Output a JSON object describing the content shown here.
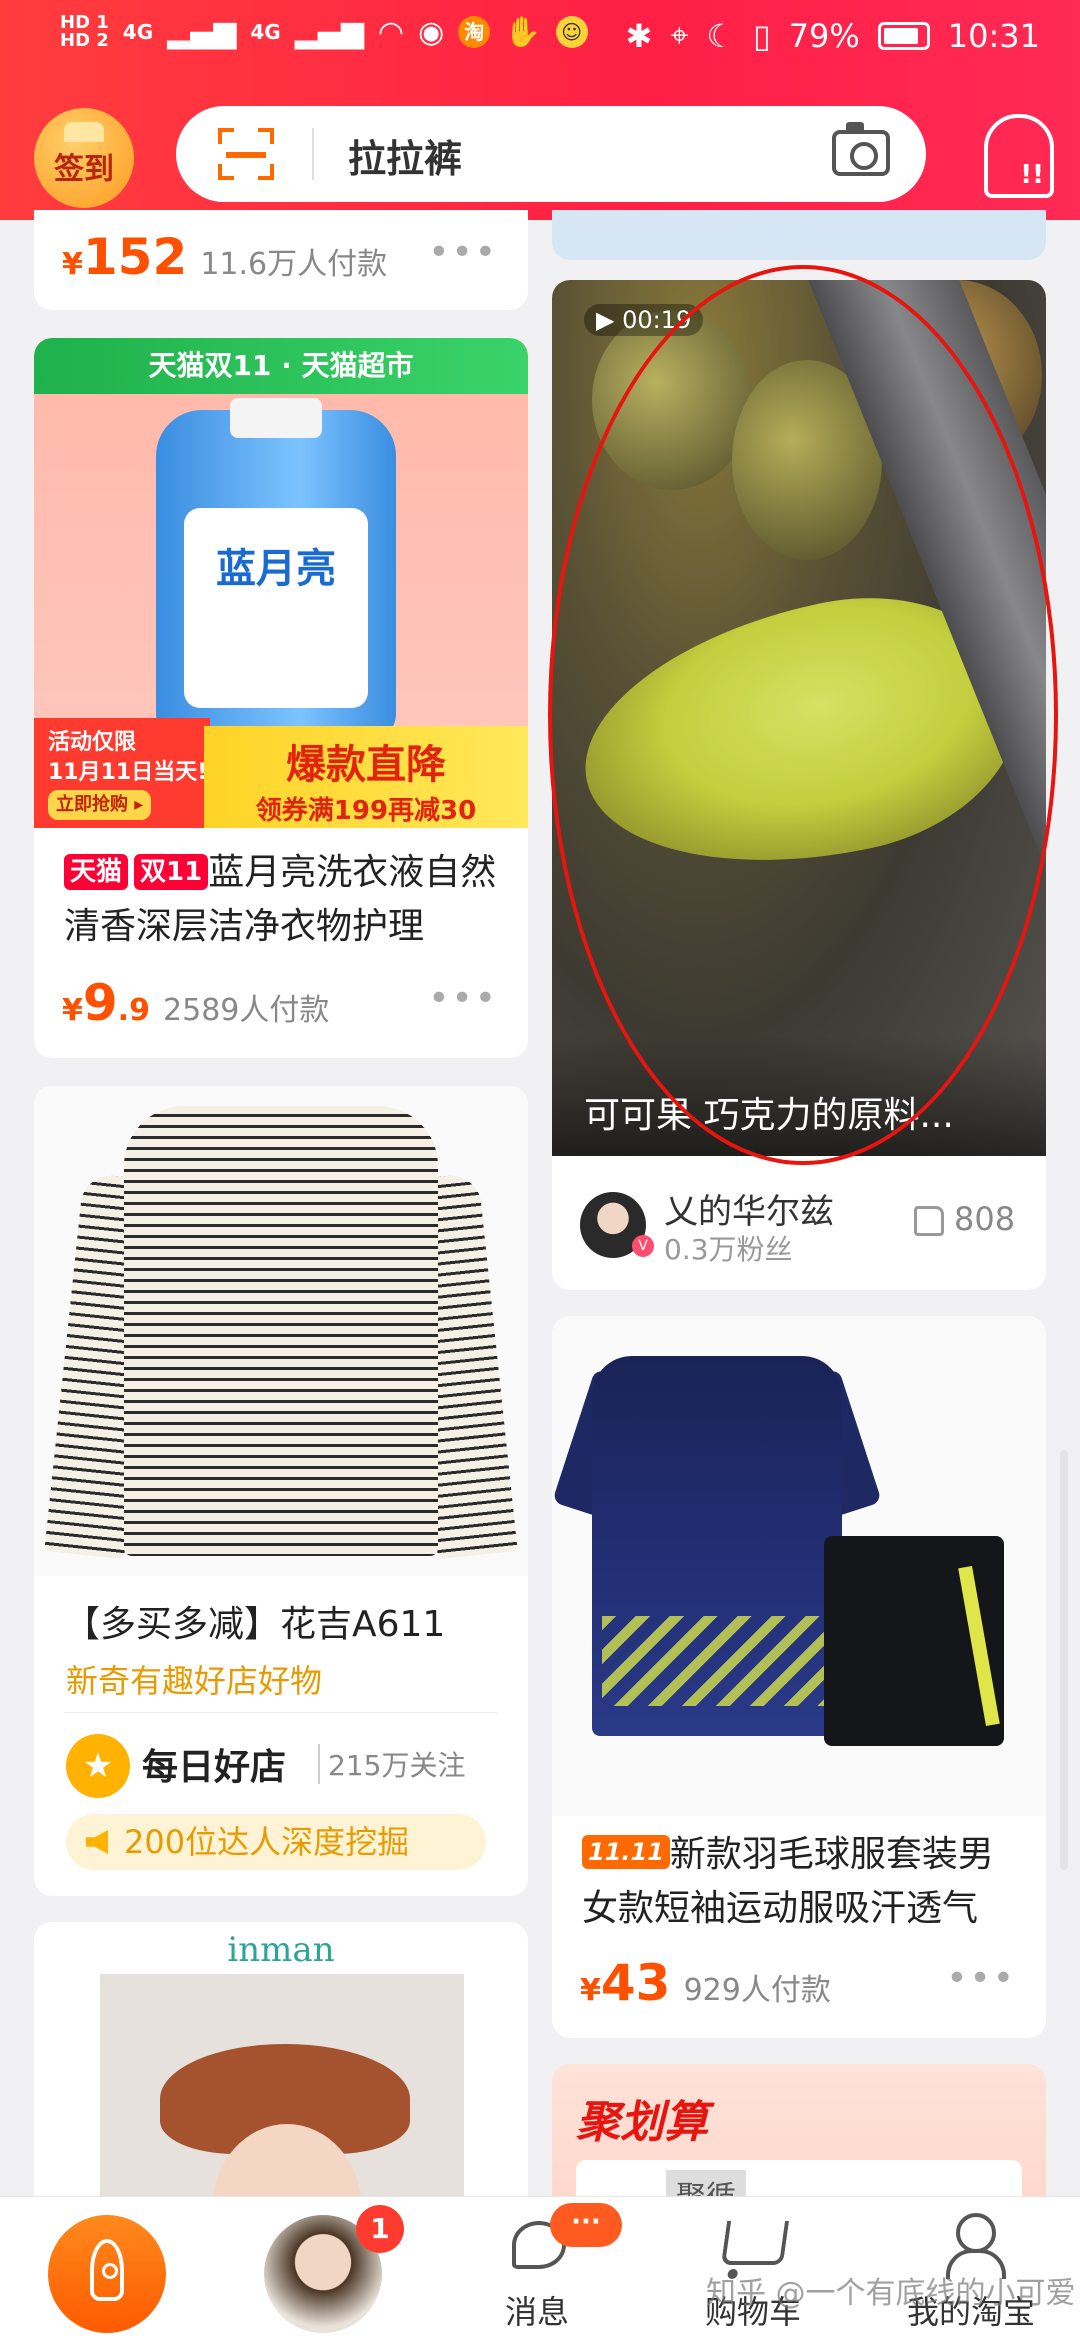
{
  "status_bar": {
    "sim1": "HD 1",
    "sim2": "HD 2",
    "signal1": "4G",
    "signal2": "4G",
    "battery": "79%",
    "time": "10:31"
  },
  "header": {
    "signin_label": "签到",
    "search_query": "拉拉裤",
    "accent": "#ff2a45"
  },
  "feed": {
    "top_card": {
      "price_int": "152",
      "price_symbol": "¥",
      "paid": "11.6万人付款"
    },
    "laundry": {
      "banner": "天猫双11 · 天猫超市",
      "brand": "蓝月亮",
      "promo_left_1": "活动仅限",
      "promo_left_2": "11月11日当天!",
      "promo_left_btn": "立即抢购 ▸",
      "promo_big": "爆款直降",
      "promo_small": "领券满199再减30",
      "tag_tmall": "天猫",
      "tag_d11": "双11",
      "title": "蓝月亮洗衣液自然清香深层洁净衣物护理",
      "price_symbol": "¥",
      "price_int": "9",
      "price_dec": ".9",
      "paid": "2589人付款"
    },
    "sweater": {
      "title": "【多买多减】花吉A611",
      "subtitle": "新奇有趣好店好物",
      "shop_name": "每日好店",
      "shop_follow": "215万关注",
      "expert": "200位达人深度挖掘"
    },
    "inman": {
      "logo": "inman"
    },
    "video": {
      "duration": "00:19",
      "caption": "可可果 巧克力的原料...",
      "author": "乂的华尔兹",
      "fans": "0.3万粉丝",
      "likes": "808"
    },
    "sport": {
      "tag": "11.11",
      "title": "新款羽毛球服套装男女款短袖运动服吸汗透气",
      "price_symbol": "¥",
      "price_int": "43",
      "paid": "929人付款"
    },
    "juhuasuan": {
      "title": "聚划算",
      "inner_text": "聚循"
    }
  },
  "bottom_nav": {
    "avatar_badge": "1",
    "messages_label": "消息",
    "messages_badge": "···",
    "cart_label": "购物车",
    "mine_label": "我的淘宝"
  },
  "watermark": "知乎 @一个有底线的小可爱"
}
